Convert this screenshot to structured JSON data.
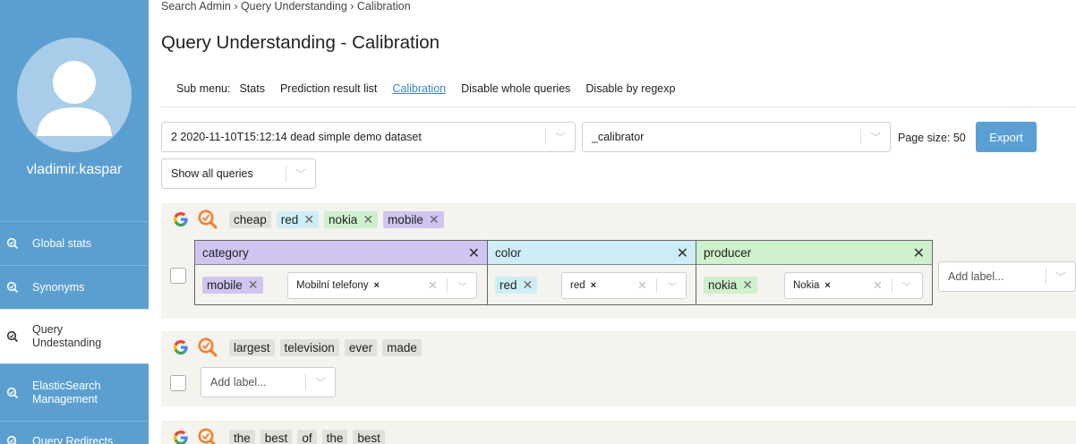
{
  "user": {
    "name": "vladimir.kaspar"
  },
  "nav": [
    {
      "label": "Global stats",
      "icon": "search-icon",
      "active": false
    },
    {
      "label": "Synonyms",
      "icon": "search-icon",
      "active": false
    },
    {
      "label": "Query Undestanding",
      "icon": "search-icon",
      "active": true
    },
    {
      "label": "ElasticSearch Management",
      "icon": "search-icon",
      "active": false
    },
    {
      "label": "Query Redirects",
      "icon": "search-icon",
      "active": false
    }
  ],
  "breadcrumb": [
    "Search Admin",
    "Query Understanding",
    "Calibration"
  ],
  "page_title": "Query Understanding - Calibration",
  "submenu": {
    "label": "Sub menu:",
    "items": [
      "Stats",
      "Prediction result list",
      "Calibration",
      "Disable whole queries",
      "Disable by regexp"
    ],
    "current": "Calibration"
  },
  "filters": {
    "dataset": "2 2020-11-10T15:12:14 dead simple demo dataset",
    "calibrator": "_calibrator",
    "page_size": "Page size: 50",
    "export_label": "Export",
    "query_filter": "Show all queries"
  },
  "queries": [
    {
      "tokens": [
        {
          "text": "cheap",
          "color": "plain",
          "removable": false
        },
        {
          "text": "red",
          "color": "cyan",
          "removable": true
        },
        {
          "text": "nokia",
          "color": "green",
          "removable": true
        },
        {
          "text": "mobile",
          "color": "purple",
          "removable": true
        }
      ],
      "slots": [
        {
          "name": "category",
          "color": "#cfc5f0",
          "token": "mobile",
          "value": "Mobilní telefony"
        },
        {
          "name": "color",
          "color": "#cdeef6",
          "token": "red",
          "value": "red"
        },
        {
          "name": "producer",
          "color": "#cdf0cd",
          "token": "nokia",
          "value": "Nokia"
        }
      ],
      "add_label_placeholder": "Add label..."
    },
    {
      "tokens": [
        {
          "text": "largest",
          "color": "plain"
        },
        {
          "text": "television",
          "color": "plain"
        },
        {
          "text": "ever",
          "color": "plain"
        },
        {
          "text": "made",
          "color": "plain"
        }
      ],
      "add_label_placeholder": "Add label..."
    },
    {
      "tokens": [
        {
          "text": "the",
          "color": "plain"
        },
        {
          "text": "best",
          "color": "plain"
        },
        {
          "text": "of",
          "color": "plain"
        },
        {
          "text": "the",
          "color": "plain"
        },
        {
          "text": "best",
          "color": "plain"
        }
      ]
    }
  ],
  "colors": {
    "sidebar": "#5b9fd1",
    "accent": "#3a85c6",
    "button": "#5aa0d4",
    "panel": "#f4f3ee"
  }
}
